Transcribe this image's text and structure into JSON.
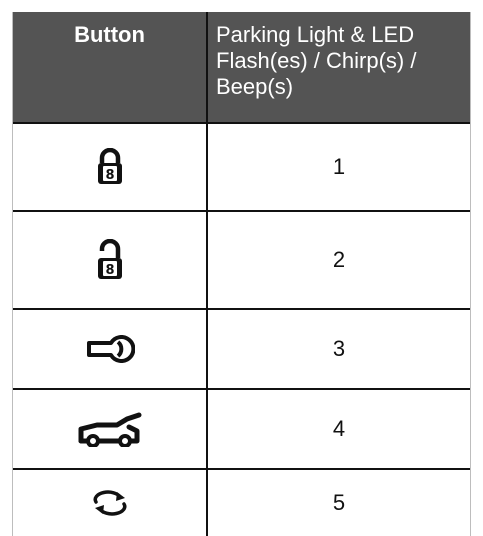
{
  "table": {
    "header": {
      "button": "Button",
      "feedback_line1": "Parking Light & LED",
      "feedback_line2": "Flash(es) / Chirp(s) /",
      "feedback_line3": "Beep(s)"
    },
    "rows": [
      {
        "icon": "lock-icon",
        "count": "1"
      },
      {
        "icon": "unlock-icon",
        "count": "2"
      },
      {
        "icon": "key-icon",
        "count": "3"
      },
      {
        "icon": "trunk-icon",
        "count": "4"
      },
      {
        "icon": "cycle-arrows-icon",
        "count": "5"
      }
    ]
  },
  "colors": {
    "header_bg": "#545454",
    "header_text": "#ffffff",
    "grid": "#111111",
    "outer_border": "#bdbdbd"
  }
}
